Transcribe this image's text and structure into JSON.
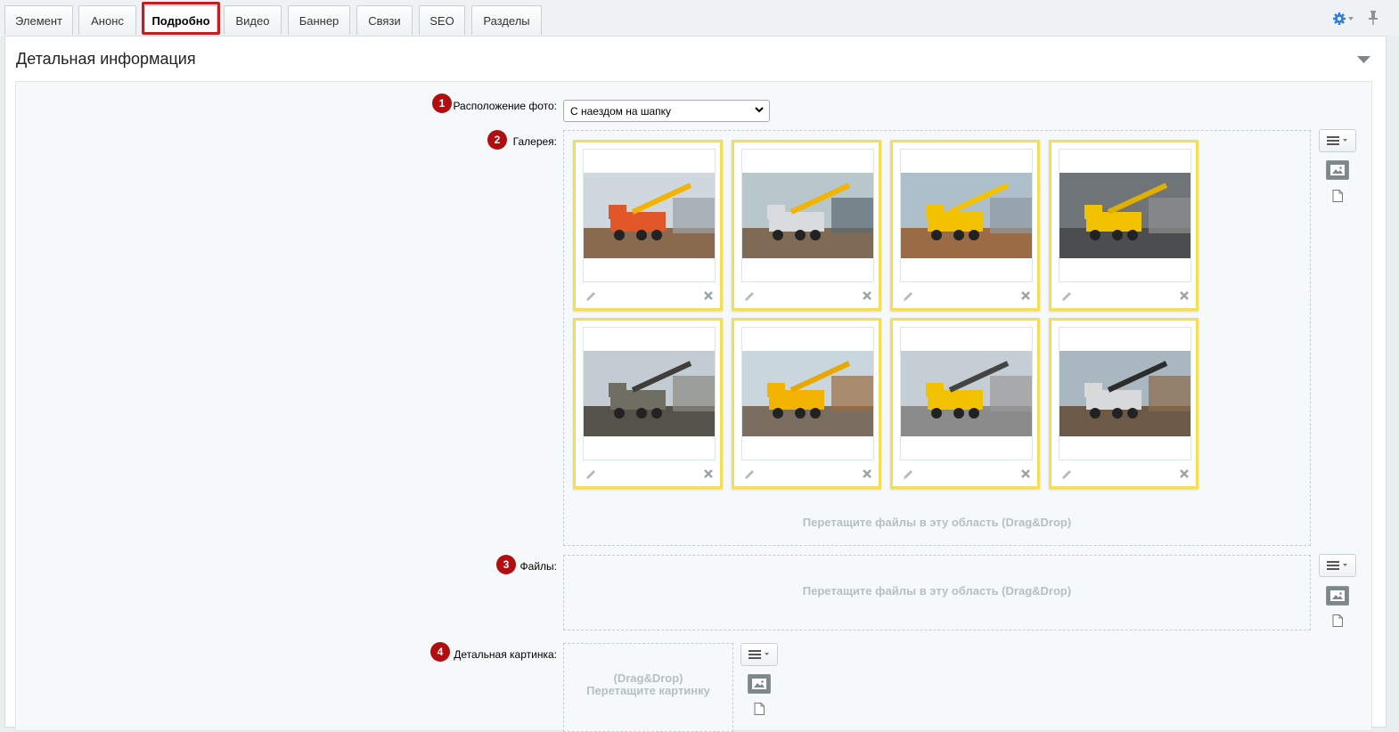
{
  "tabs": [
    {
      "label": "Элемент",
      "active": false
    },
    {
      "label": "Анонс",
      "active": false
    },
    {
      "label": "Подробно",
      "active": true
    },
    {
      "label": "Видео",
      "active": false
    },
    {
      "label": "Баннер",
      "active": false
    },
    {
      "label": "Связи",
      "active": false
    },
    {
      "label": "SEO",
      "active": false
    },
    {
      "label": "Разделы",
      "active": false
    }
  ],
  "section": {
    "title": "Детальная информация"
  },
  "fields": {
    "photo_position": {
      "number": "1",
      "label": "Расположение фото:",
      "value": "С наездом на шапку"
    },
    "gallery": {
      "number": "2",
      "label": "Галерея:",
      "drop_text": "Перетащите файлы в эту область (Drag&Drop)"
    },
    "files": {
      "number": "3",
      "label": "Файлы:",
      "drop_text": "Перетащите файлы в эту область (Drag&Drop)"
    },
    "detail_image": {
      "number": "4",
      "label": "Детальная картинка:",
      "drop_line1": "(Drag&Drop)",
      "drop_line2": "Перетащите картинку"
    }
  },
  "gallery_images": [
    "crane-truck-orange-icon",
    "crane-truck-white-icon",
    "mobile-crane-yellow-icon",
    "dump-truck-yellow-icon",
    "excavator-icon",
    "crane-manipulator-truck-icon",
    "tipper-truck-yellow-icon",
    "timber-loader-truck-icon"
  ],
  "colors": {
    "accent_red": "#b10e12",
    "thumb_border": "#f6dd57",
    "highlight": "#c61e1e",
    "gear": "#2f7ed8"
  }
}
